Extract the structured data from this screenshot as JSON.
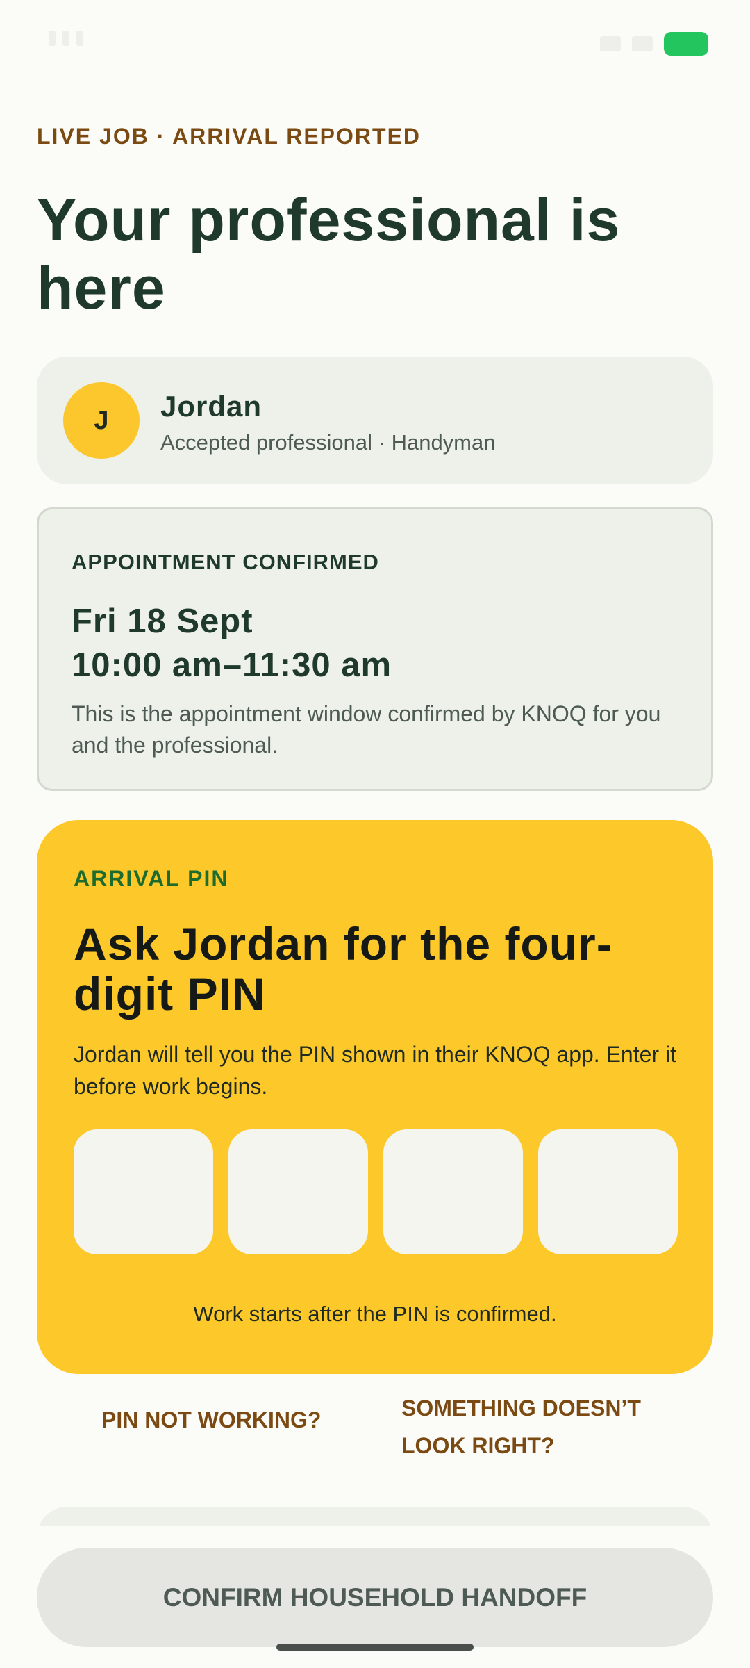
{
  "status_bar": {
    "battery_color": "#22C55E",
    "icons": [
      "signal-icon",
      "wifi-icon",
      "battery-icon"
    ]
  },
  "header": {
    "eyebrow": "LIVE JOB · ARRIVAL REPORTED",
    "title": "Your professional is here"
  },
  "professional": {
    "initial": "J",
    "name": "Jordan",
    "subtitle": "Accepted professional · Handyman"
  },
  "appointment": {
    "eyebrow": "APPOINTMENT CONFIRMED",
    "date": "Fri 18 Sept",
    "time": "10:00 am–11:30 am",
    "note": "This is the appointment window confirmed by KNOQ for you and the professional."
  },
  "pin": {
    "eyebrow": "ARRIVAL PIN",
    "title": "Ask Jordan for the four-digit PIN",
    "description": "Jordan will tell you the PIN shown in their KNOQ app. Enter it before work begins.",
    "digits": [
      "",
      "",
      "",
      ""
    ],
    "footer": "Work starts after the PIN is confirmed."
  },
  "links": {
    "pin_not_working": "PIN NOT WORKING?",
    "something_wrong": "SOMETHING DOESN’T LOOK RIGHT?"
  },
  "actions": {
    "confirm_label": "CONFIRM HOUSEHOLD HANDOFF"
  },
  "colors": {
    "accent_yellow": "#FDC82A",
    "brand_green": "#1F3A2D",
    "link_brown": "#7A4A12",
    "pin_eyebrow_green": "#1E6B2E"
  }
}
